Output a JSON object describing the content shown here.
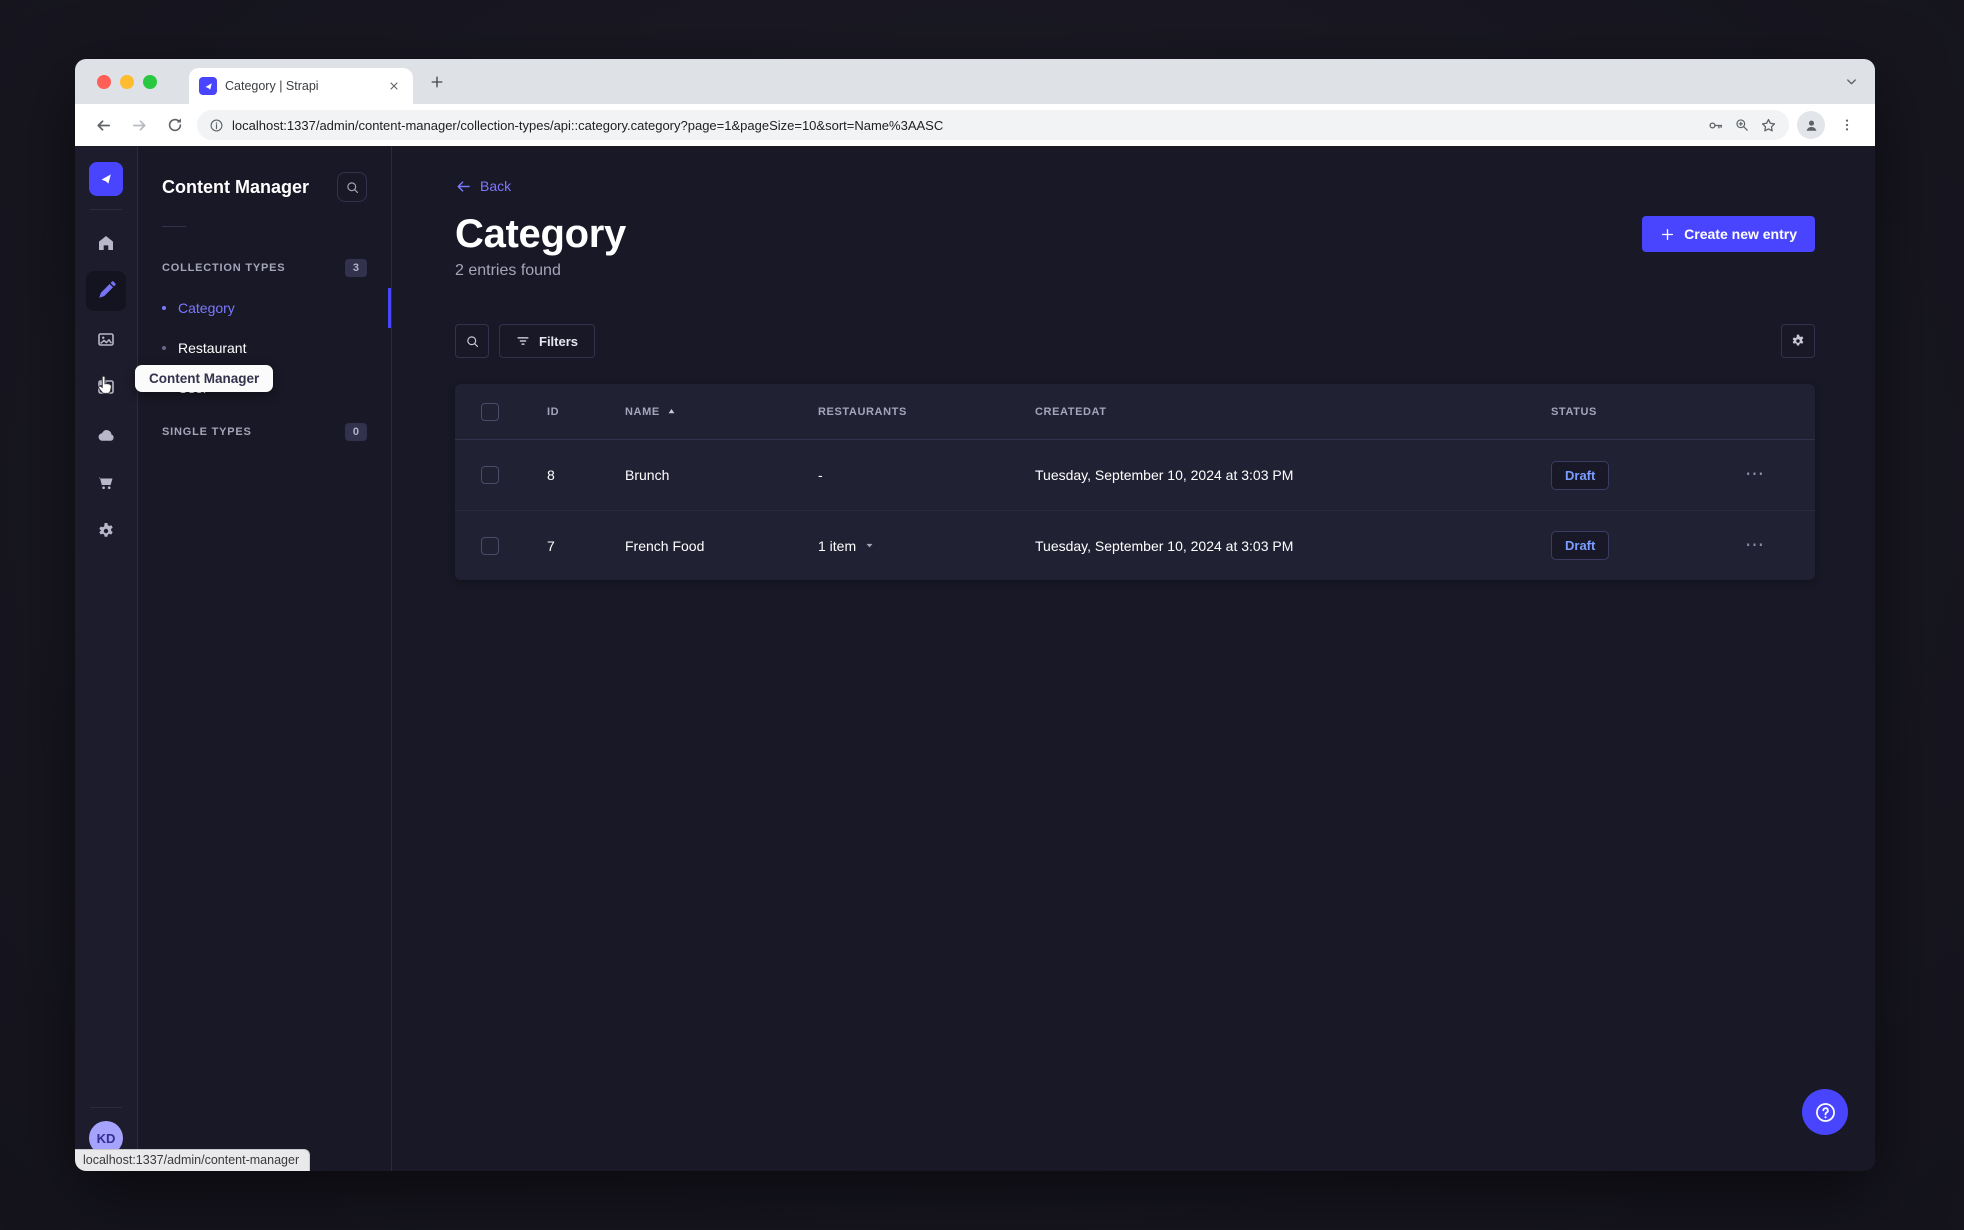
{
  "colors": {
    "primary": "#4945ff",
    "primary_light": "#7b79ff",
    "draft_text": "#7b9dff",
    "traffic_red": "#ff5f57",
    "traffic_yellow": "#febc2e",
    "traffic_green": "#28c840"
  },
  "browser": {
    "tab_title": "Category | Strapi",
    "url": "localhost:1337/admin/content-manager/collection-types/api::category.category?page=1&pageSize=10&sort=Name%3AASC",
    "status_bar_link": "localhost:1337/admin/content-manager"
  },
  "nav_rail": {
    "icons": [
      "strapi-logo",
      "home",
      "content-manager",
      "media-library",
      "content-type-builder",
      "cloud",
      "marketplace-cart",
      "settings-gear"
    ],
    "avatar_initials": "KD"
  },
  "sidebar": {
    "title": "Content Manager",
    "tooltip": "Content Manager",
    "sections": [
      {
        "label": "COLLECTION TYPES",
        "badge": "3",
        "items": [
          {
            "label": "Category",
            "active": true
          },
          {
            "label": "Restaurant",
            "active": false
          },
          {
            "label": "User",
            "active": false
          }
        ]
      },
      {
        "label": "SINGLE TYPES",
        "badge": "0",
        "items": []
      }
    ]
  },
  "main": {
    "back_label": "Back",
    "title": "Category",
    "subtitle": "2 entries found",
    "create_button_label": "Create new entry",
    "filters_button_label": "Filters"
  },
  "table": {
    "columns": [
      "ID",
      "NAME",
      "RESTAURANTS",
      "CREATEDAT",
      "STATUS"
    ],
    "rows": [
      {
        "id": "8",
        "name": "Brunch",
        "restaurants": "-",
        "restaurants_expandable": false,
        "created_at": "Tuesday, September 10, 2024 at 3:03 PM",
        "status": "Draft"
      },
      {
        "id": "7",
        "name": "French Food",
        "restaurants": "1 item",
        "restaurants_expandable": true,
        "created_at": "Tuesday, September 10, 2024 at 3:03 PM",
        "status": "Draft"
      }
    ]
  }
}
